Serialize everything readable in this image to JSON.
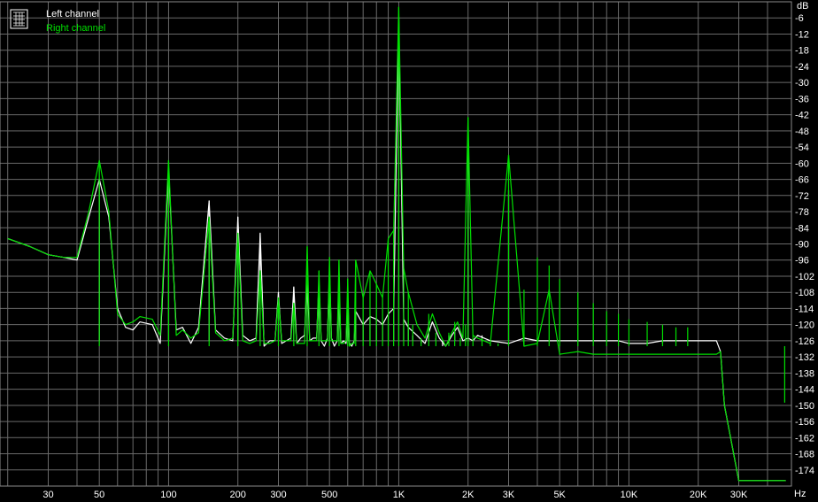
{
  "chart_data": {
    "type": "line",
    "x_scale": "log",
    "xlim": [
      20,
      48000
    ],
    "ylim": [
      -180,
      0
    ],
    "grid": true,
    "legend_position": "top-left",
    "y_unit": "dB",
    "x_unit": "Hz",
    "y_ticks": [
      -6,
      -12,
      -18,
      -24,
      -30,
      -36,
      -42,
      -48,
      -54,
      -60,
      -66,
      -72,
      -78,
      -84,
      -90,
      -96,
      -102,
      -108,
      -114,
      -120,
      -126,
      -132,
      -138,
      -144,
      -150,
      -156,
      -162,
      -168,
      -174
    ],
    "y_tick_labels": [
      "-6",
      "-12",
      "-18",
      "-24",
      "-30",
      "-36",
      "-42",
      "-48",
      "-54",
      "-60",
      "-66",
      "-72",
      "-78",
      "-84",
      "-90",
      "-96",
      "-102",
      "-108",
      "-114",
      "-120",
      "-126",
      "-132",
      "-138",
      "-144",
      "-150",
      "-156",
      "-162",
      "-168",
      "-174"
    ],
    "x_ticks": [
      30,
      50,
      100,
      200,
      300,
      500,
      1000,
      2000,
      3000,
      5000,
      10000,
      20000,
      30000
    ],
    "x_tick_labels": [
      "30",
      "50",
      "100",
      "200",
      "300",
      "500",
      "1K",
      "2K",
      "3K",
      "5K",
      "10K",
      "20K",
      "30K"
    ],
    "series": [
      {
        "name": "Left channel",
        "color": "#ffffff",
        "x": [
          20,
          25,
          30,
          35,
          40,
          45,
          50,
          55,
          60,
          65,
          70,
          75,
          85,
          92,
          100,
          108,
          115,
          125,
          135,
          150,
          160,
          175,
          190,
          200,
          210,
          225,
          240,
          250,
          260,
          275,
          290,
          300,
          310,
          325,
          340,
          350,
          360,
          375,
          390,
          400,
          410,
          425,
          440,
          450,
          460,
          475,
          490,
          500,
          510,
          525,
          540,
          550,
          560,
          575,
          590,
          600,
          610,
          625,
          640,
          650,
          700,
          750,
          800,
          850,
          900,
          950,
          1000,
          1050,
          1100,
          1200,
          1300,
          1400,
          1500,
          1600,
          1700,
          1800,
          1900,
          2000,
          2100,
          2200,
          2500,
          3000,
          3500,
          4000,
          4500,
          5000,
          6000,
          7000,
          8000,
          9000,
          10000,
          12000,
          14000,
          16000,
          18000,
          20000,
          22000,
          23500,
          24000,
          25000,
          26000,
          30000,
          40000,
          47500,
          48000
        ],
        "y": [
          -88,
          -91,
          -94,
          -95,
          -96,
          -80,
          -66,
          -80,
          -114,
          -121,
          -122,
          -119,
          -120,
          -127,
          -62,
          -122,
          -121,
          -127,
          -121,
          -74,
          -122,
          -125,
          -126,
          -80,
          -124,
          -126,
          -125,
          -86,
          -128,
          -126,
          -126,
          -108,
          -127,
          -126,
          -125,
          -106,
          -127,
          -125,
          -124,
          -102,
          -126,
          -125,
          -125,
          -104,
          -126,
          -128,
          -125,
          -100,
          -125,
          -128,
          -126,
          -105,
          -127,
          -126,
          -127,
          -110,
          -127,
          -128,
          -126,
          -115,
          -120,
          -117,
          -118,
          -120,
          -116,
          -114,
          -6,
          -118,
          -121,
          -124,
          -127,
          -119,
          -125,
          -128,
          -124,
          -121,
          -126,
          -125,
          -126,
          -124,
          -126,
          -127,
          -125,
          -126,
          -126,
          -126,
          -126,
          -126,
          -126,
          -126,
          -127,
          -127,
          -126,
          -126,
          -126,
          -126,
          -126,
          -126,
          -126,
          -130,
          -150,
          -178,
          -178,
          -178,
          -178
        ]
      },
      {
        "name": "Right channel",
        "color": "#00e000",
        "x": [
          20,
          25,
          30,
          35,
          40,
          45,
          50,
          55,
          60,
          65,
          70,
          75,
          85,
          92,
          100,
          108,
          115,
          125,
          135,
          150,
          160,
          175,
          190,
          200,
          210,
          225,
          240,
          250,
          260,
          275,
          290,
          300,
          310,
          325,
          340,
          350,
          360,
          375,
          390,
          400,
          410,
          425,
          440,
          450,
          460,
          475,
          490,
          500,
          510,
          525,
          540,
          550,
          560,
          575,
          590,
          600,
          610,
          625,
          640,
          650,
          700,
          750,
          800,
          850,
          900,
          950,
          1000,
          1050,
          1100,
          1200,
          1300,
          1400,
          1500,
          1600,
          1700,
          1800,
          1900,
          2000,
          2100,
          2200,
          2500,
          3000,
          3500,
          4000,
          4500,
          5000,
          6000,
          7000,
          8000,
          9000,
          10000,
          12000,
          14000,
          16000,
          18000,
          20000,
          22000,
          23500,
          24000,
          25000,
          26000,
          30000,
          40000,
          47500,
          48000
        ],
        "y": [
          -88,
          -91,
          -94,
          -95,
          -95,
          -78,
          -59,
          -78,
          -116,
          -120,
          -119,
          -117,
          -118,
          -124,
          -59,
          -124,
          -122,
          -125,
          -123,
          -80,
          -123,
          -126,
          -125,
          -86,
          -126,
          -127,
          -126,
          -100,
          -127,
          -127,
          -126,
          -110,
          -126,
          -126,
          -126,
          -112,
          -127,
          -127,
          -127,
          -91,
          -126,
          -126,
          -126,
          -100,
          -126,
          -126,
          -126,
          -95,
          -126,
          -126,
          -126,
          -96,
          -127,
          -127,
          -126,
          -103,
          -128,
          -127,
          -127,
          -96,
          -110,
          -100,
          -105,
          -110,
          -88,
          -85,
          -2,
          -99,
          -108,
          -120,
          -125,
          -116,
          -123,
          -128,
          -123,
          -119,
          -125,
          -43,
          -124,
          -125,
          -127,
          -57,
          -128,
          -127,
          -107,
          -131,
          -130,
          -131,
          -131,
          -131,
          -131,
          -131,
          -131,
          -131,
          -131,
          -131,
          -131,
          -131,
          -131,
          -130,
          -150,
          -178,
          -178,
          -178,
          -178
        ]
      }
    ],
    "peaks": {
      "Left channel": {
        "x": [
          50,
          100,
          150,
          200,
          250,
          300,
          350,
          400,
          450,
          500,
          550,
          600,
          650,
          700,
          750,
          800,
          850,
          900,
          950,
          1000,
          1050,
          1100,
          1150,
          1250,
          1350,
          1450,
          1550,
          1650,
          1750,
          1850,
          1950,
          2000,
          2100,
          2300,
          2500,
          2700,
          3000,
          3500,
          4000,
          4500,
          5000,
          6000,
          7000,
          8000,
          9000,
          10000,
          12000,
          14000,
          16000,
          18000
        ],
        "y": [
          -66,
          -62,
          -74,
          -80,
          -86,
          -108,
          -106,
          -102,
          -104,
          -100,
          -105,
          -110,
          -115,
          -120,
          -117,
          -118,
          -120,
          -116,
          -114,
          -6,
          -118,
          -121,
          -124,
          -127,
          -119,
          -125,
          -128,
          -124,
          -121,
          -126,
          -125,
          -54,
          -126,
          -124,
          -126,
          -126,
          -70,
          -124,
          -125,
          -126,
          -126,
          -126,
          -126,
          -126,
          -126,
          -126,
          -127,
          -127,
          -126,
          -126
        ]
      },
      "Right channel": {
        "x": [
          50,
          100,
          150,
          200,
          250,
          300,
          350,
          400,
          450,
          500,
          550,
          600,
          650,
          700,
          750,
          800,
          850,
          900,
          950,
          1000,
          1050,
          1100,
          1150,
          1250,
          1350,
          1450,
          1550,
          1650,
          1750,
          1850,
          1950,
          2000,
          2100,
          2300,
          2500,
          2700,
          3000,
          3500,
          4000,
          4500,
          5000,
          6000,
          7000,
          8000,
          9000,
          10000,
          12000,
          14000,
          16000,
          18000,
          47500
        ],
        "y": [
          -59,
          -59,
          -80,
          -86,
          -100,
          -110,
          -112,
          -91,
          -100,
          -95,
          -96,
          -103,
          -96,
          -110,
          -100,
          -105,
          -110,
          -88,
          -85,
          -2,
          -99,
          -108,
          -120,
          -125,
          -116,
          -123,
          -128,
          -123,
          -119,
          -125,
          -120,
          -43,
          -124,
          -125,
          -127,
          -127,
          -57,
          -107,
          -95,
          -98,
          -103,
          -108,
          -112,
          -115,
          -116,
          -118,
          -119,
          -120,
          -121,
          -121,
          -149
        ]
      }
    }
  }
}
